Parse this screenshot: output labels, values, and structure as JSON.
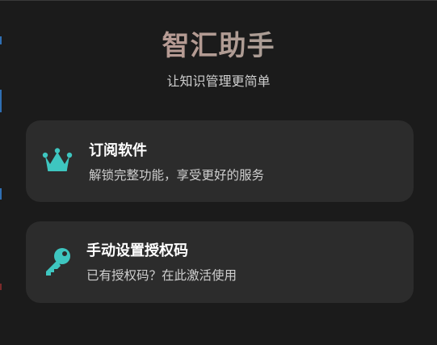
{
  "header": {
    "title": "智汇助手",
    "subtitle": "让知识管理更简单"
  },
  "options": [
    {
      "icon": "crown-icon",
      "label": "订阅软件",
      "description": "解锁完整功能，享受更好的服务"
    },
    {
      "icon": "key-icon",
      "label": "手动设置授权码",
      "description": "已有授权码？在此激活使用"
    }
  ],
  "colors": {
    "background": "#1b1b1b",
    "card": "#2c2c2c",
    "accent": "#3ec6c0",
    "title_gradient_start": "#c89d97",
    "title_gradient_end": "#96a39a"
  }
}
